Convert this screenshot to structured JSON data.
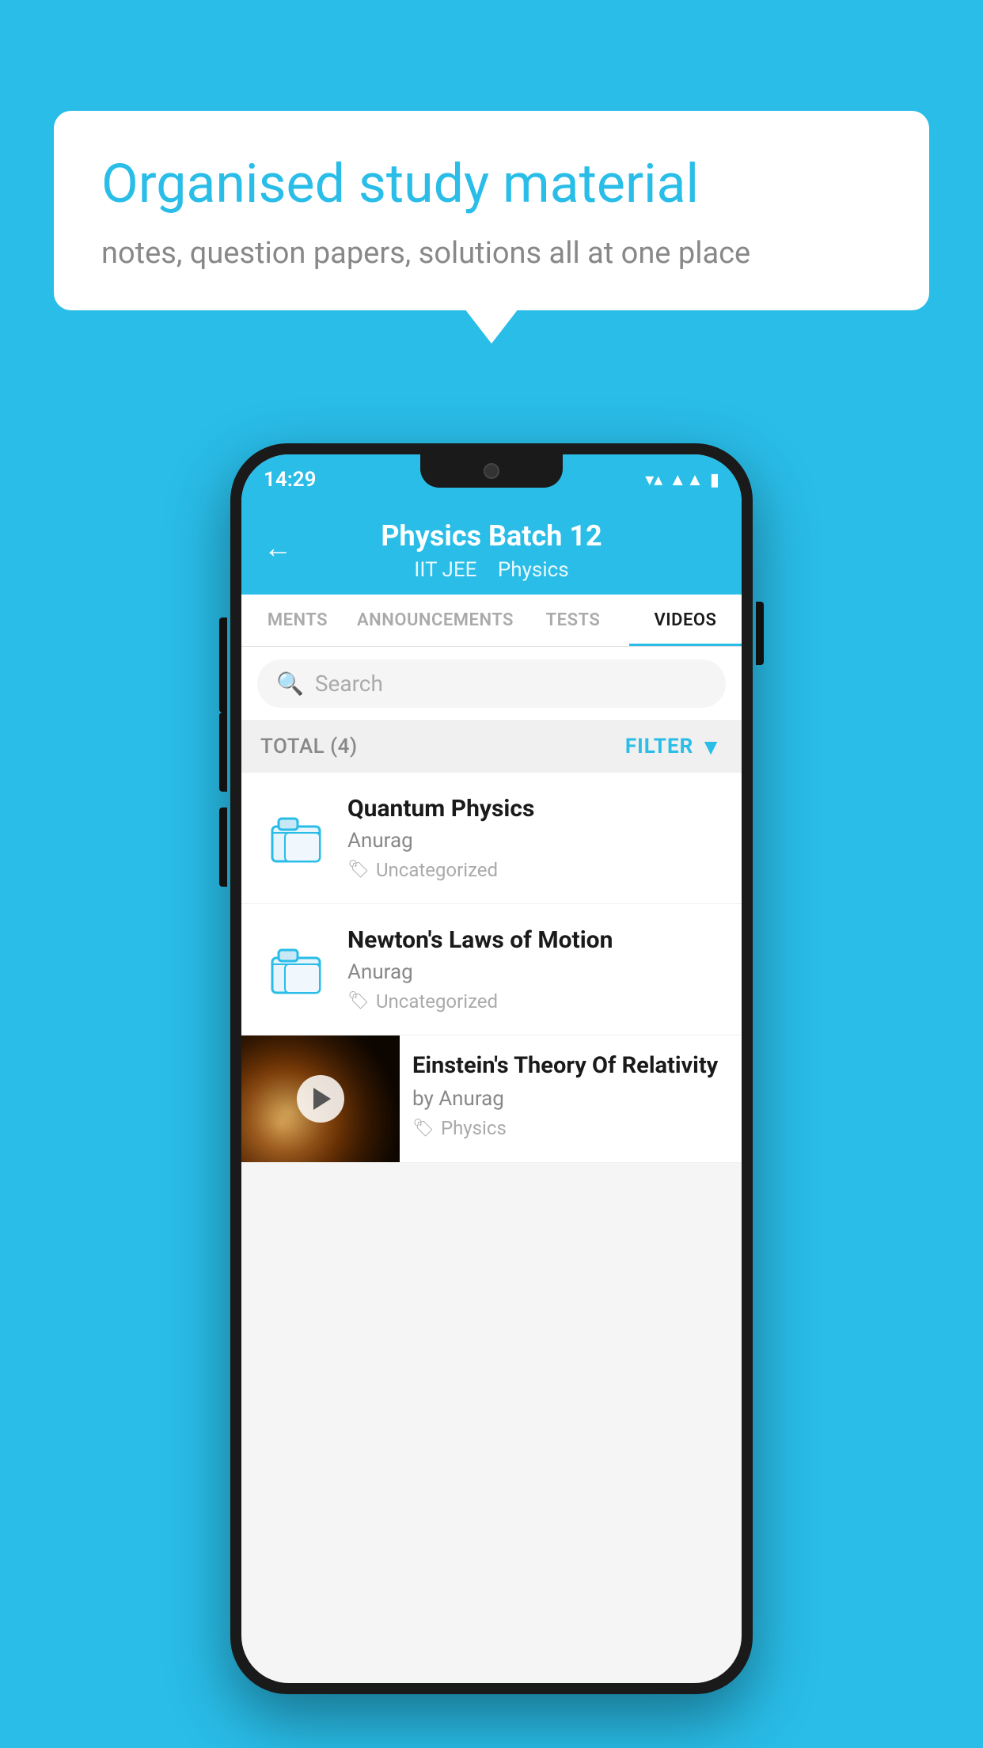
{
  "background_color": "#29bde8",
  "bubble": {
    "title": "Organised study material",
    "subtitle": "notes, question papers, solutions all at one place"
  },
  "status_bar": {
    "time": "14:29",
    "wifi": "▼▲",
    "battery": "▮"
  },
  "header": {
    "title": "Physics Batch 12",
    "subtitle_left": "IIT JEE",
    "subtitle_right": "Physics",
    "back_label": "←"
  },
  "tabs": [
    {
      "label": "MENTS",
      "active": false
    },
    {
      "label": "ANNOUNCEMENTS",
      "active": false
    },
    {
      "label": "TESTS",
      "active": false
    },
    {
      "label": "VIDEOS",
      "active": true
    }
  ],
  "search": {
    "placeholder": "Search"
  },
  "filter_bar": {
    "total_label": "TOTAL (4)",
    "filter_label": "FILTER"
  },
  "videos": [
    {
      "title": "Quantum Physics",
      "author": "Anurag",
      "tag": "Uncategorized",
      "type": "folder"
    },
    {
      "title": "Newton's Laws of Motion",
      "author": "Anurag",
      "tag": "Uncategorized",
      "type": "folder"
    },
    {
      "title": "Einstein's Theory Of Relativity",
      "author": "by Anurag",
      "tag": "Physics",
      "type": "video"
    }
  ]
}
